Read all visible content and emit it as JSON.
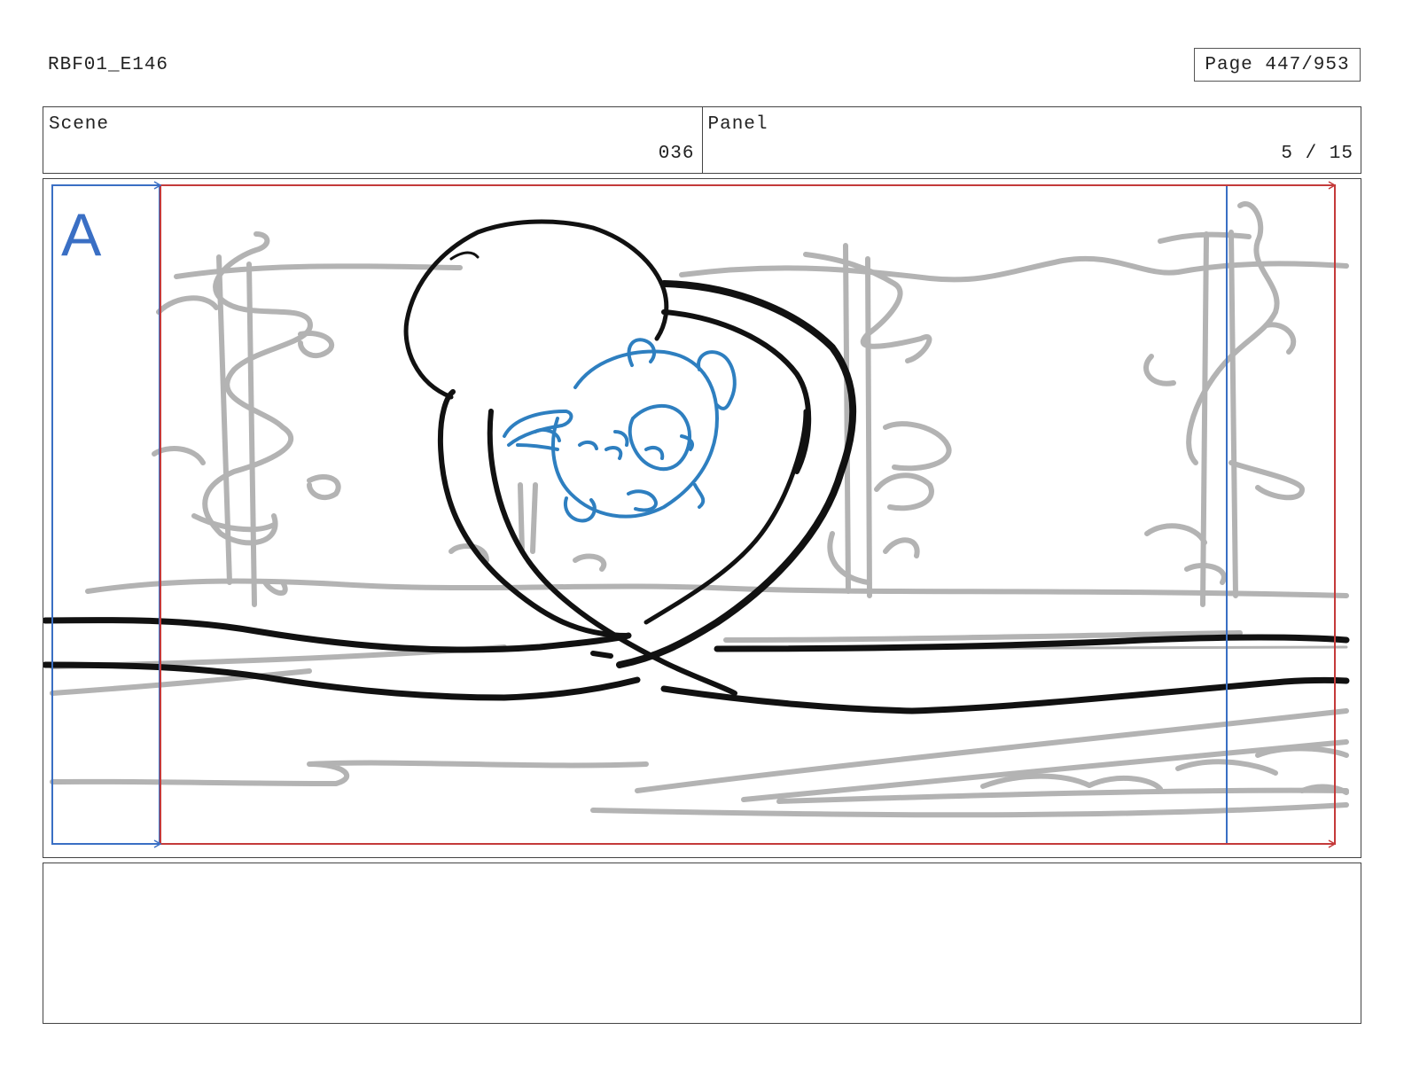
{
  "header": {
    "doc_id": "RBF01_E146",
    "page_label": "Page 447/953"
  },
  "info": {
    "scene_label": "Scene",
    "scene_value": "036",
    "panel_label": "Panel",
    "panel_value": "5 / 15"
  },
  "frame": {
    "layer_letter": "A",
    "colors": {
      "background_sketch": "#b3b3b3",
      "ink_lines": "#111111",
      "character_lines": "#2e7fc0",
      "camera_start": "#3a6fc4",
      "camera_end": "#c43a3a"
    }
  },
  "notes": {
    "text": ""
  }
}
